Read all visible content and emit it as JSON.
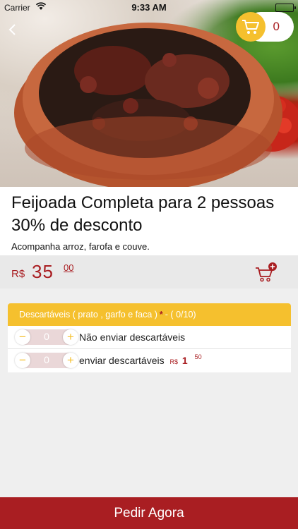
{
  "status_bar": {
    "carrier": "Carrier",
    "time": "9:33 AM"
  },
  "header": {
    "cart_count": "0",
    "icons": {
      "back": "back-arrow-icon",
      "cart": "cart-icon"
    }
  },
  "product": {
    "title": "Feijoada Completa para 2 pessoas 30% de desconto",
    "description": "Acompanha arroz, farofa e couve.",
    "price_currency": "R$",
    "price_int": "35",
    "price_cents": "00"
  },
  "options": {
    "header_label": "Descartáveis ( prato , garfo e faca )",
    "required_mark": "*",
    "header_counter": "- ( 0/10)",
    "items": [
      {
        "minus": "−",
        "qty": "0",
        "plus": "+",
        "label": "Não enviar descartáveis"
      },
      {
        "minus": "−",
        "qty": "0",
        "plus": "+",
        "label": "enviar descartáveis",
        "price_currency": "R$",
        "price_int": "1",
        "price_cents": "50"
      }
    ]
  },
  "footer": {
    "order_label": "Pedir Agora"
  },
  "colors": {
    "accent_yellow": "#f5c02e",
    "brand_red": "#a91e22"
  }
}
